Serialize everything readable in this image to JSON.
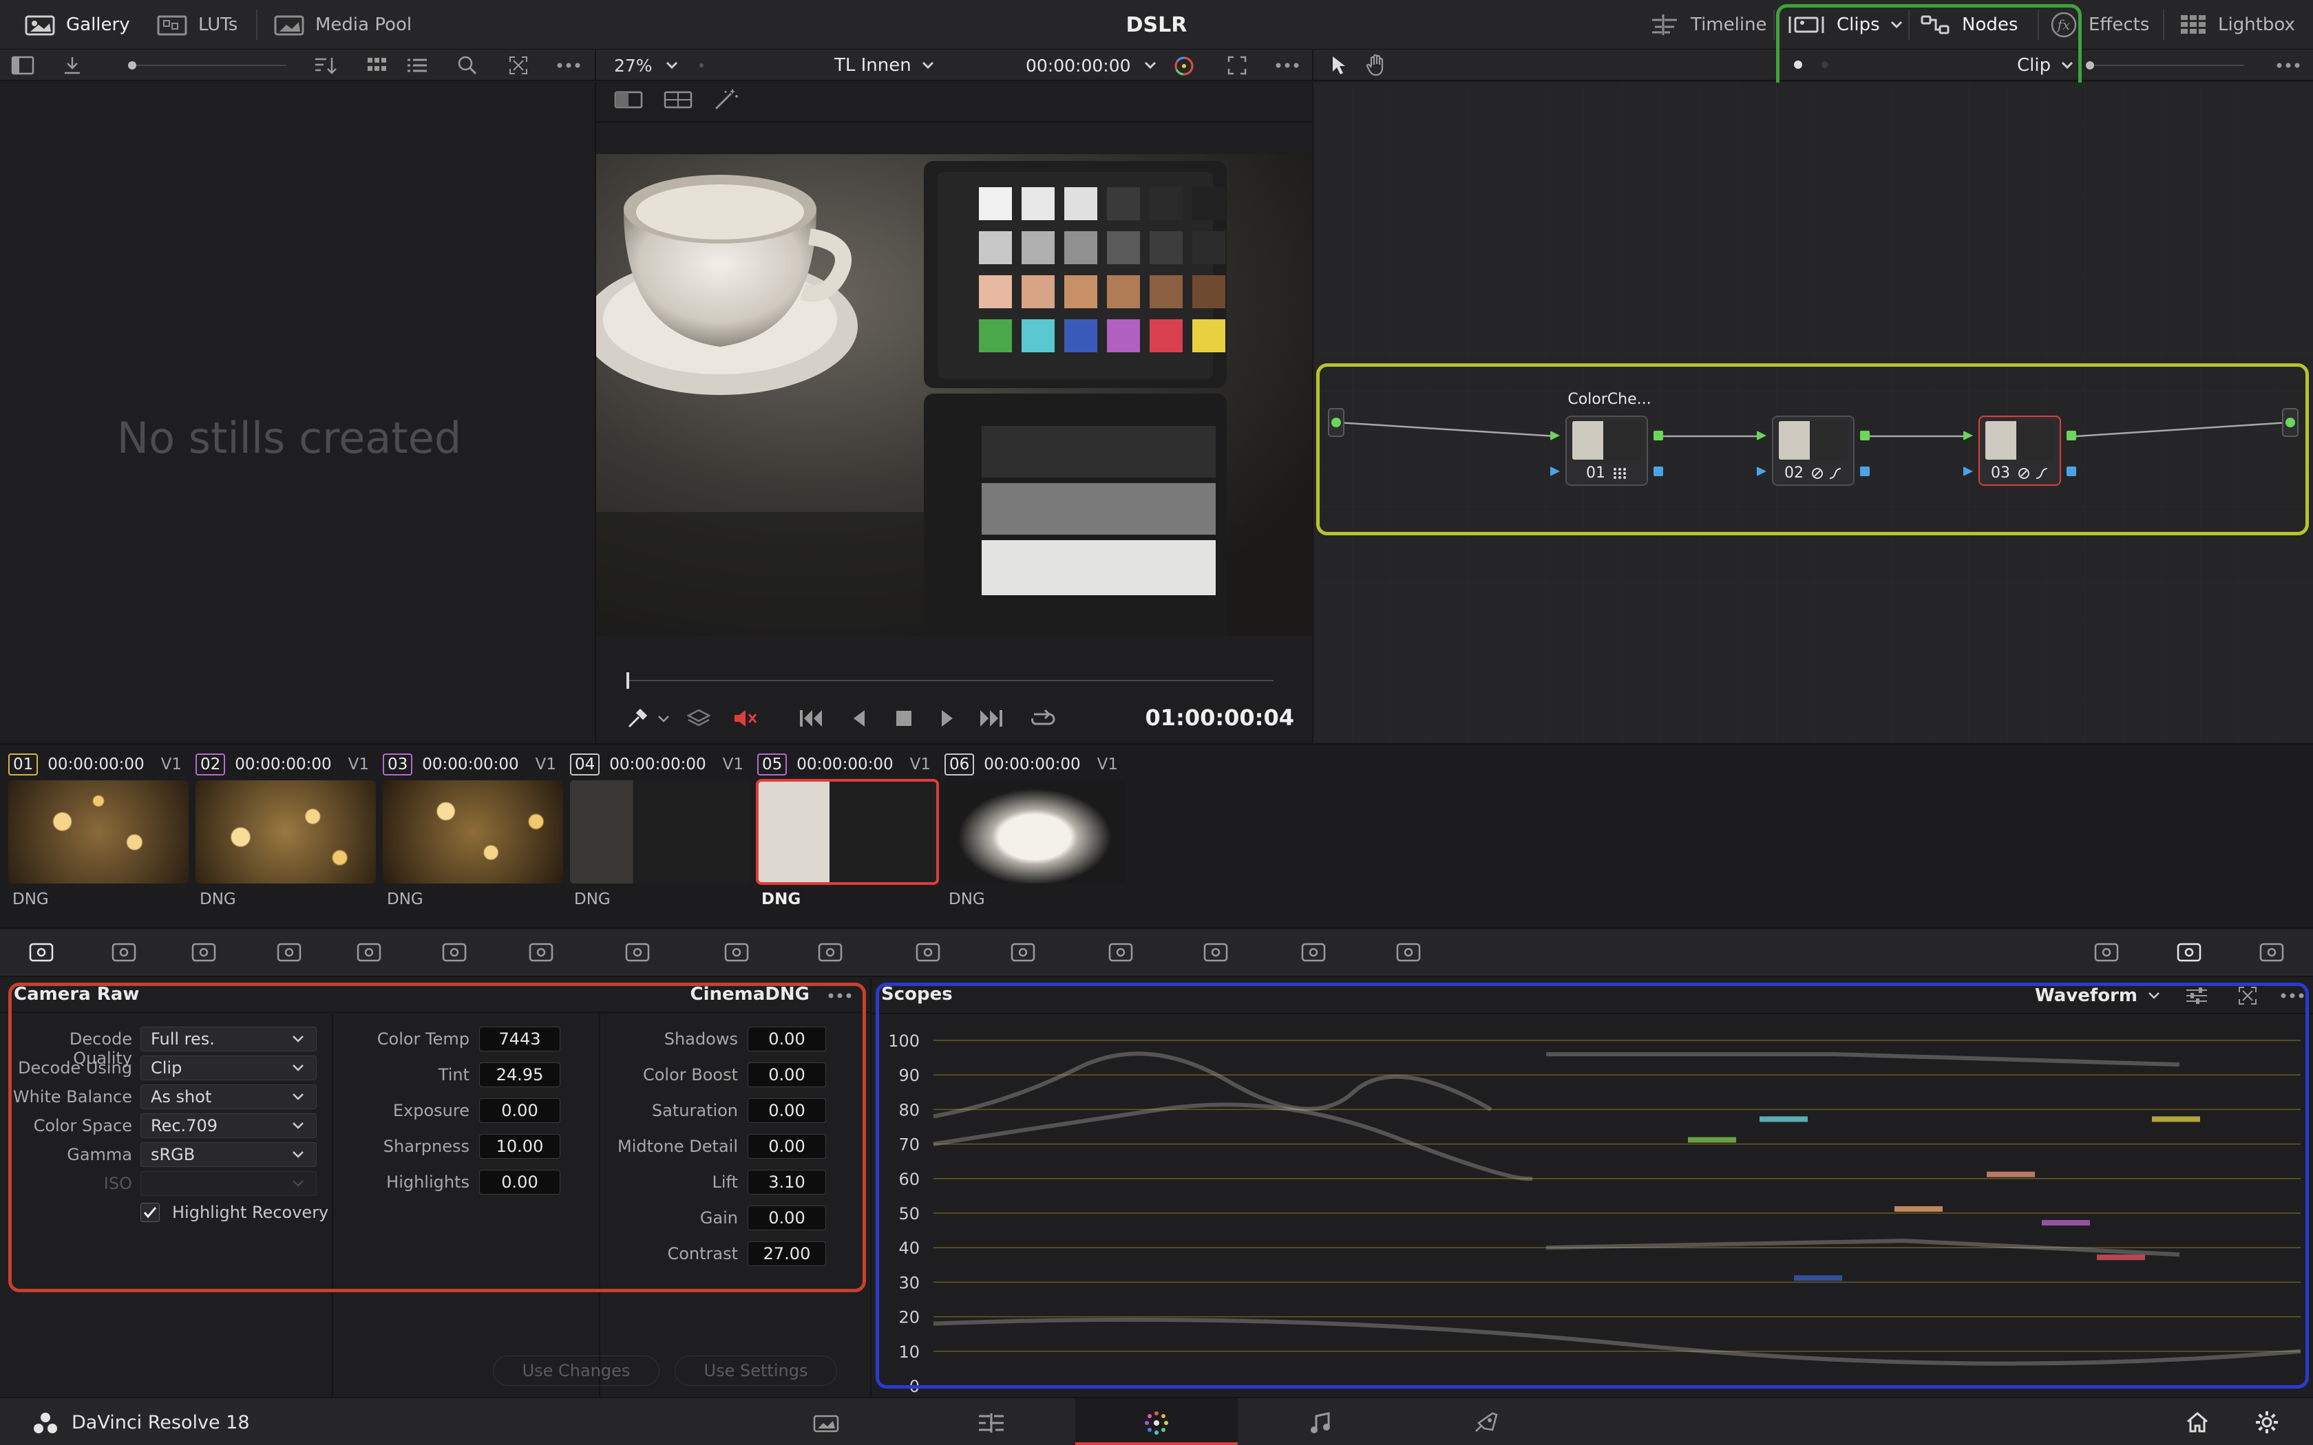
{
  "topbar": {
    "gallery": "Gallery",
    "luts": "LUTs",
    "media_pool": "Media Pool",
    "project_title": "DSLR",
    "timeline": "Timeline",
    "clips": "Clips",
    "nodes": "Nodes",
    "effects": "Effects",
    "lightbox": "Lightbox"
  },
  "viewer": {
    "zoom": "27%",
    "timeline_name": "TL Innen",
    "timecode_top": "00:00:00:00",
    "timecode": "01:00:00:04"
  },
  "nodes_panel": {
    "mode": "Clip",
    "nodes": [
      {
        "id": "01",
        "label": "ColorChe..."
      },
      {
        "id": "02",
        "label": ""
      },
      {
        "id": "03",
        "label": ""
      }
    ]
  },
  "gallery": {
    "empty_message": "No stills created"
  },
  "clips": [
    {
      "num": "01",
      "tc": "00:00:00:00",
      "track": "V1",
      "format": "DNG",
      "color": "#d9b43a"
    },
    {
      "num": "02",
      "tc": "00:00:00:00",
      "track": "V1",
      "format": "DNG",
      "color": "#b66ad0"
    },
    {
      "num": "03",
      "tc": "00:00:00:00",
      "track": "V1",
      "format": "DNG",
      "color": "#b66ad0"
    },
    {
      "num": "04",
      "tc": "00:00:00:00",
      "track": "V1",
      "format": "DNG",
      "color": "#c8c8c8"
    },
    {
      "num": "05",
      "tc": "00:00:00:00",
      "track": "V1",
      "format": "DNG",
      "color": "#b66ad0"
    },
    {
      "num": "06",
      "tc": "00:00:00:00",
      "track": "V1",
      "format": "DNG",
      "color": "#c8c8c8"
    }
  ],
  "camera_raw": {
    "title": "Camera Raw",
    "format": "CinemaDNG",
    "decode_quality_label": "Decode Quality",
    "decode_quality": "Full res.",
    "decode_using_label": "Decode Using",
    "decode_using": "Clip",
    "white_balance_label": "White Balance",
    "white_balance": "As shot",
    "color_space_label": "Color Space",
    "color_space": "Rec.709",
    "gamma_label": "Gamma",
    "gamma": "sRGB",
    "iso_label": "ISO",
    "highlight_recovery": "Highlight Recovery",
    "color_temp_label": "Color Temp",
    "color_temp": "7443",
    "tint_label": "Tint",
    "tint": "24.95",
    "exposure_label": "Exposure",
    "exposure": "0.00",
    "sharpness_label": "Sharpness",
    "sharpness": "10.00",
    "highlights_label": "Highlights",
    "highlights": "0.00",
    "shadows_label": "Shadows",
    "shadows": "0.00",
    "color_boost_label": "Color Boost",
    "color_boost": "0.00",
    "saturation_label": "Saturation",
    "saturation": "0.00",
    "midtone_detail_label": "Midtone Detail",
    "midtone_detail": "0.00",
    "lift_label": "Lift",
    "lift": "3.10",
    "gain_label": "Gain",
    "gain": "0.00",
    "contrast_label": "Contrast",
    "contrast": "27.00",
    "use_changes": "Use Changes",
    "use_settings": "Use Settings"
  },
  "scopes": {
    "title": "Scopes",
    "mode": "Waveform",
    "ticks": [
      "100",
      "90",
      "80",
      "70",
      "60",
      "50",
      "40",
      "30",
      "20",
      "10",
      "0"
    ]
  },
  "bottom": {
    "app_name": "DaVinci Resolve 18"
  }
}
